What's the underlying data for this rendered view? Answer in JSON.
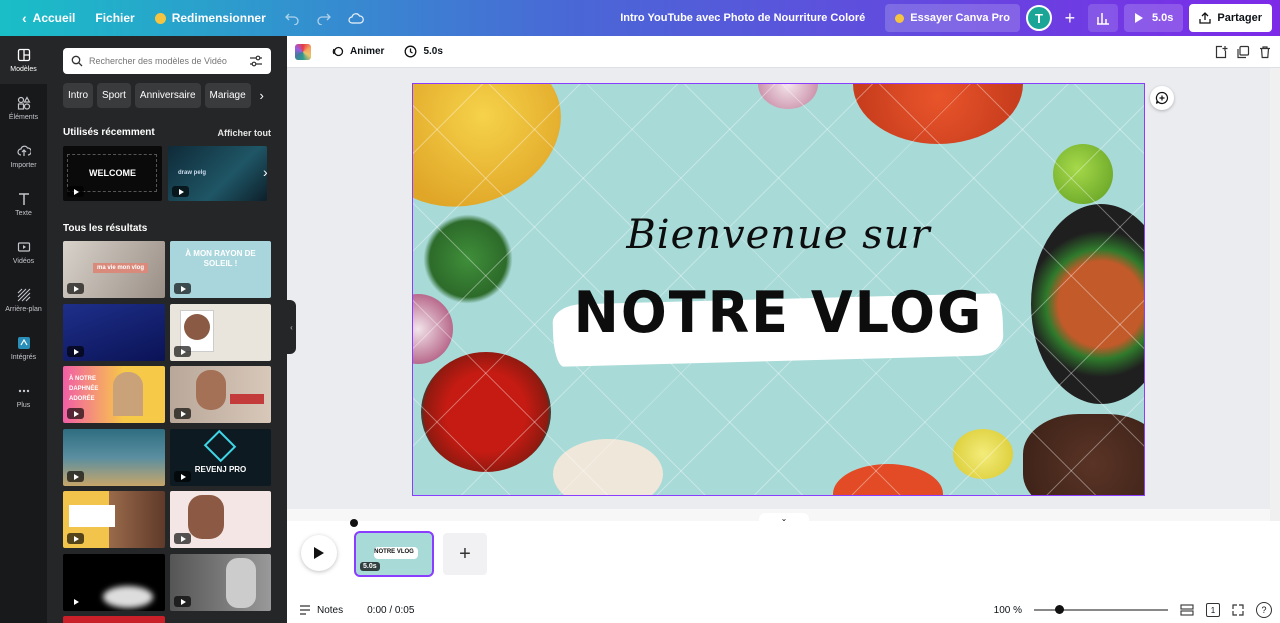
{
  "topbar": {
    "back_label": "Accueil",
    "file_label": "Fichier",
    "resize_label": "Redimensionner",
    "doc_title": "Intro YouTube avec Photo de Nourriture Coloré",
    "pro_label": "Essayer Canva Pro",
    "avatar_letter": "T",
    "duration_label": "5.0s",
    "share_label": "Partager"
  },
  "rail": {
    "items": [
      {
        "label": "Modèles"
      },
      {
        "label": "Éléments"
      },
      {
        "label": "Importer"
      },
      {
        "label": "Texte"
      },
      {
        "label": "Vidéos"
      },
      {
        "label": "Arrière-plan"
      },
      {
        "label": "Intégrés"
      },
      {
        "label": "Plus"
      }
    ]
  },
  "panel": {
    "search_placeholder": "Rechercher des modèles de Vidéo",
    "chips": [
      "Intro",
      "Sport",
      "Anniversaire",
      "Mariage"
    ],
    "recent_title": "Utilisés récemment",
    "recent_link": "Afficher tout",
    "results_title": "Tous les résultats",
    "thumb_texts": [
      "WELCOME",
      "draw pelg",
      "ma vie mon vlog",
      "À MON RAYON DE SOLEIL !",
      "À NOTRE DAPHNÉE ADORÉE",
      "REVENJ PRO"
    ]
  },
  "editor": {
    "animate_label": "Animer",
    "duration_label": "5.0s"
  },
  "canvas": {
    "script_text": "Bienvenue sur",
    "main_text": "NOTRE VLOG"
  },
  "timeline": {
    "clip_duration": "5.0s",
    "clip_title": "NOTRE VLOG",
    "add_label": "+"
  },
  "bottom": {
    "notes_label": "Notes",
    "time_label": "0:00 / 0:05",
    "zoom_label": "100 %",
    "zoom_percent": 100,
    "page_count": "1"
  }
}
